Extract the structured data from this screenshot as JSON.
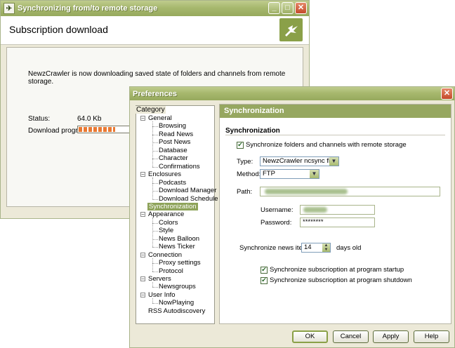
{
  "bg_window": {
    "title": "Synchronizing from/to remote storage",
    "header_title": "Subscription download",
    "message": "NewzCrawler is now downloading saved state of folders and channels from remote storage.",
    "status_label": "Status:",
    "status_value": "64.0 Kb",
    "progress_label": "Download progress:",
    "progress_fraction": 0.6
  },
  "prefs": {
    "title": "Preferences",
    "category_caption": "Category",
    "tree": [
      {
        "label": "General",
        "level": 0,
        "expanded": true
      },
      {
        "label": "Browsing",
        "level": 1
      },
      {
        "label": "Read News",
        "level": 1
      },
      {
        "label": "Post News",
        "level": 1
      },
      {
        "label": "Database",
        "level": 1
      },
      {
        "label": "Character",
        "level": 1
      },
      {
        "label": "Confirmations",
        "level": 1
      },
      {
        "label": "Enclosures",
        "level": 0,
        "expanded": true
      },
      {
        "label": "Podcasts",
        "level": 1
      },
      {
        "label": "Download Manager",
        "level": 1
      },
      {
        "label": "Download Schedule",
        "level": 1
      },
      {
        "label": "Synchronization",
        "level": 0,
        "selected": true
      },
      {
        "label": "Appearance",
        "level": 0,
        "expanded": true
      },
      {
        "label": "Colors",
        "level": 1
      },
      {
        "label": "Style",
        "level": 1
      },
      {
        "label": "News Balloon",
        "level": 1
      },
      {
        "label": "News Ticker",
        "level": 1
      },
      {
        "label": "Connection",
        "level": 0,
        "expanded": true
      },
      {
        "label": "Proxy settings",
        "level": 1
      },
      {
        "label": "Protocol",
        "level": 1
      },
      {
        "label": "Servers",
        "level": 0,
        "expanded": true
      },
      {
        "label": "Newsgroups",
        "level": 1
      },
      {
        "label": "User Info",
        "level": 0,
        "expanded": true
      },
      {
        "label": "NowPlaying",
        "level": 1
      },
      {
        "label": "RSS Autodiscovery",
        "level": 0
      }
    ],
    "panel_header": "Synchronization",
    "section_title": "Synchronization",
    "sync_checkbox": "Synchronize folders and channels with remote storage",
    "type_label": "Type:",
    "type_value": "NewzCrawler ncsync file",
    "method_label": "Method:",
    "method_value": "FTP",
    "path_label": "Path:",
    "username_label": "Username:",
    "password_label": "Password:",
    "password_value": "********",
    "news_items_label": "Synchronize news items",
    "news_items_value": "14",
    "days_old_label": "days old",
    "startup_checkbox": "Synchronize subscriоption at program startup",
    "shutdown_checkbox": "Synchronize subscriоption at program shutdown",
    "buttons": {
      "ok": "OK",
      "cancel": "Cancel",
      "apply": "Apply",
      "help": "Help"
    }
  },
  "colors": {
    "accent": "#96a760",
    "title_bar": "#a7b86e",
    "progress": "#e97932"
  }
}
